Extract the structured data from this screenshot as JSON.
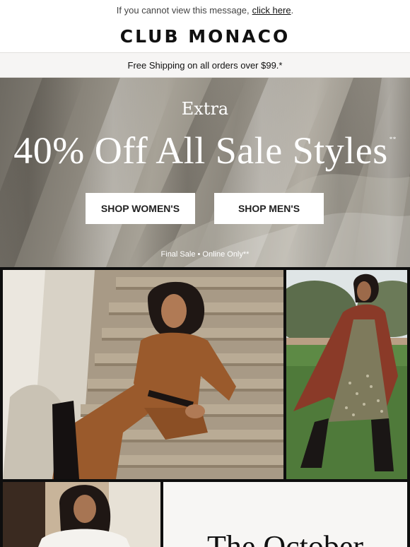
{
  "preheader": {
    "text": "If you cannot view this message,",
    "link": "click here",
    "period": "."
  },
  "brand": {
    "logo": "CLUB MONACO"
  },
  "shipping": {
    "text": "Free Shipping on all orders over $99.*"
  },
  "hero": {
    "eyebrow": "Extra",
    "headline": "40% Off All Sale Styles",
    "headline_mark": "**",
    "buttons": {
      "women": "SHOP WOMEN'S",
      "men": "SHOP MEN'S"
    },
    "fine_print": "Final Sale • Online Only**"
  },
  "feature": {
    "title": "The October"
  },
  "colors": {
    "hero_taupe": "#8a857b",
    "sweater_rust": "#9a5a2c",
    "cape_red": "#8a3a28",
    "lawn_green": "#4f7a3a"
  }
}
